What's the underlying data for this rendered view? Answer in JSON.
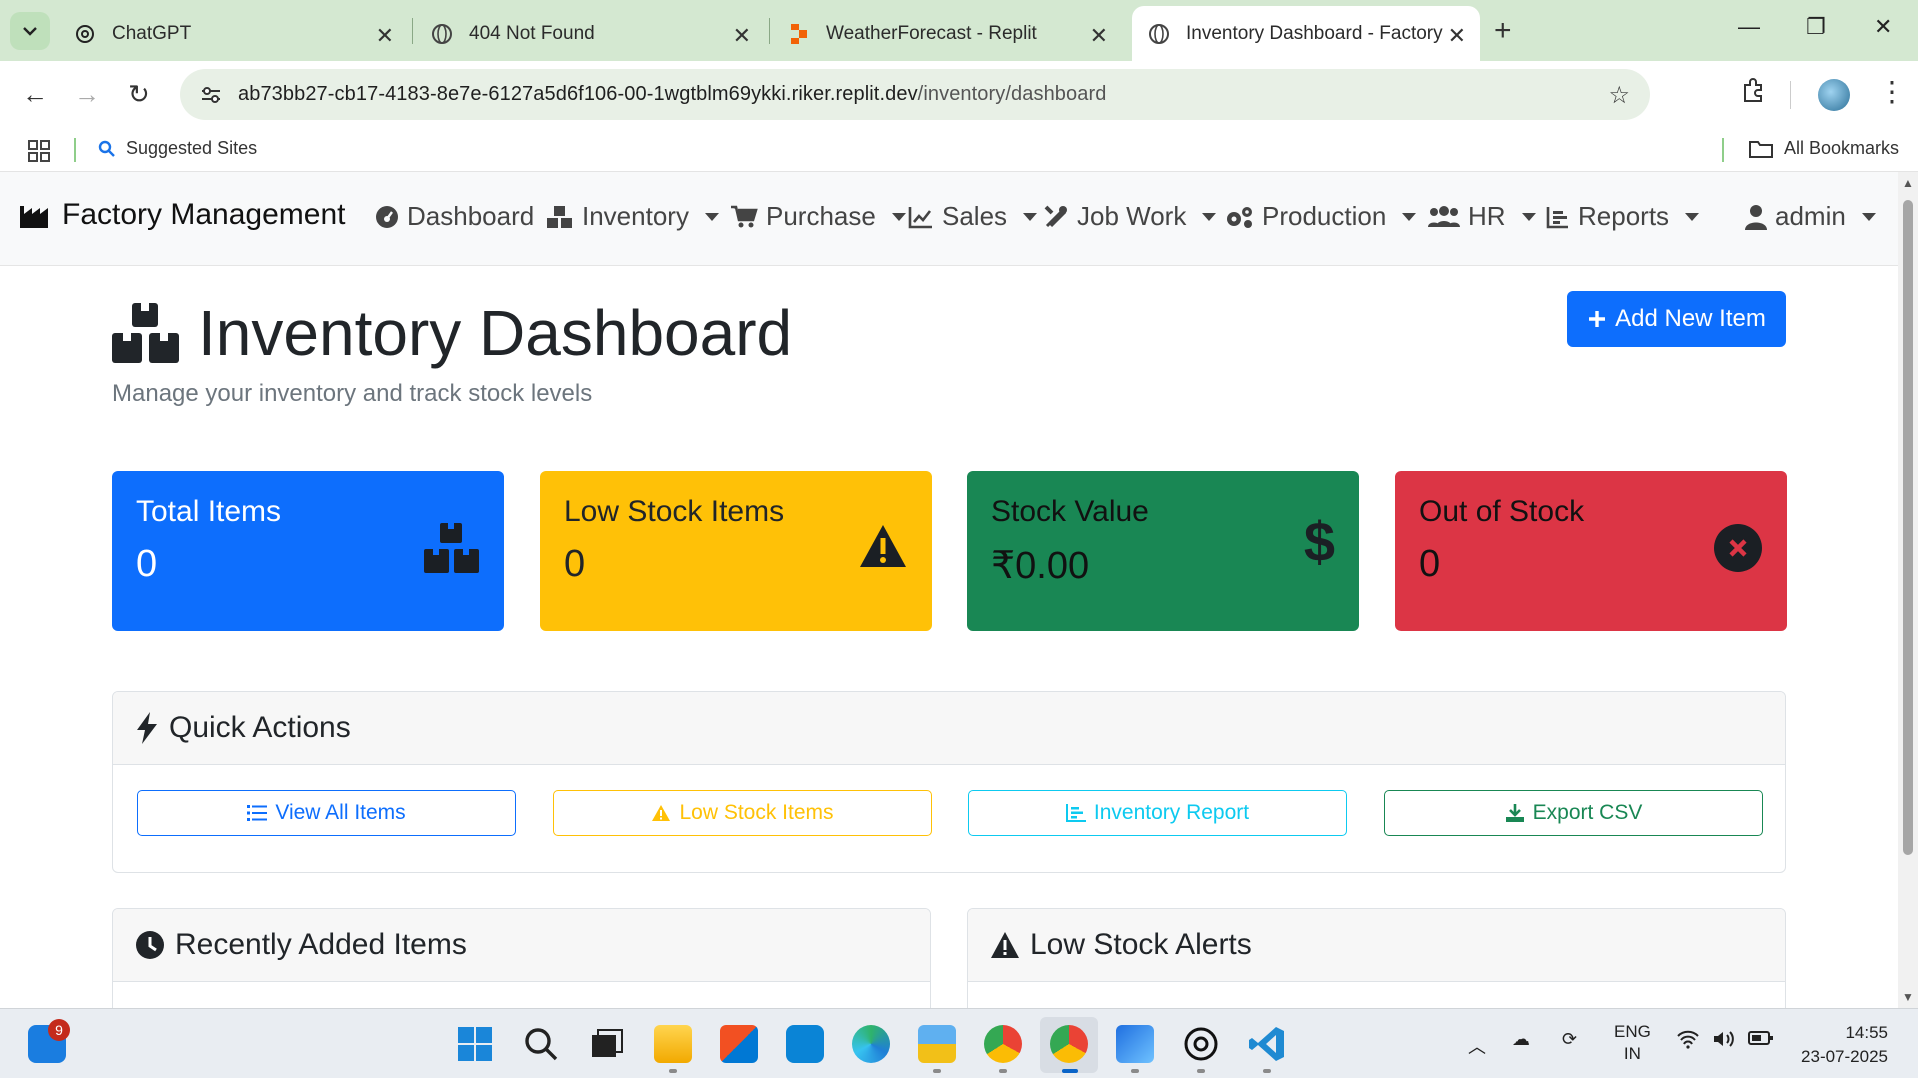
{
  "browser": {
    "tabs": [
      {
        "title": "ChatGPT"
      },
      {
        "title": "404 Not Found"
      },
      {
        "title": "WeatherForecast - Replit"
      },
      {
        "title": "Inventory Dashboard - Factory I"
      }
    ],
    "url_host": "ab73bb27-cb17-4183-8e7e-6127a5d6f106-00-1wgtblm69ykki.riker.replit.dev",
    "url_path": "/inventory/dashboard",
    "bookmarks": {
      "suggested": "Suggested Sites",
      "all": "All Bookmarks"
    }
  },
  "app": {
    "brand": "Factory Management",
    "nav": [
      {
        "label": "Dashboard"
      },
      {
        "label": "Inventory"
      },
      {
        "label": "Purchase"
      },
      {
        "label": "Sales"
      },
      {
        "label": "Job Work"
      },
      {
        "label": "Production"
      },
      {
        "label": "HR"
      },
      {
        "label": "Reports"
      }
    ],
    "user": "admin"
  },
  "page": {
    "title": "Inventory Dashboard",
    "subtitle": "Manage your inventory and track stock levels",
    "add_button": "Add New Item"
  },
  "stats": [
    {
      "label": "Total Items",
      "value": "0",
      "color": "#0d6efd",
      "icon": "boxes-icon"
    },
    {
      "label": "Low Stock Items",
      "value": "0",
      "color": "#ffc107",
      "icon": "warning-icon"
    },
    {
      "label": "Stock Value",
      "value": "₹0.00",
      "color": "#198754",
      "icon": "dollar-icon"
    },
    {
      "label": "Out of Stock",
      "value": "0",
      "color": "#dc3545",
      "icon": "x-circle-icon"
    }
  ],
  "quick_actions": {
    "title": "Quick Actions",
    "buttons": [
      {
        "label": "View All Items",
        "color": "#0d6efd"
      },
      {
        "label": "Low Stock Items",
        "color": "#ffc107"
      },
      {
        "label": "Inventory Report",
        "color": "#0dcaf0"
      },
      {
        "label": "Export CSV",
        "color": "#198754"
      }
    ]
  },
  "panels": {
    "recent": "Recently Added Items",
    "alerts": "Low Stock Alerts"
  },
  "taskbar": {
    "badge": "9",
    "lang1": "ENG",
    "lang2": "IN",
    "time": "14:55",
    "date": "23-07-2025"
  }
}
